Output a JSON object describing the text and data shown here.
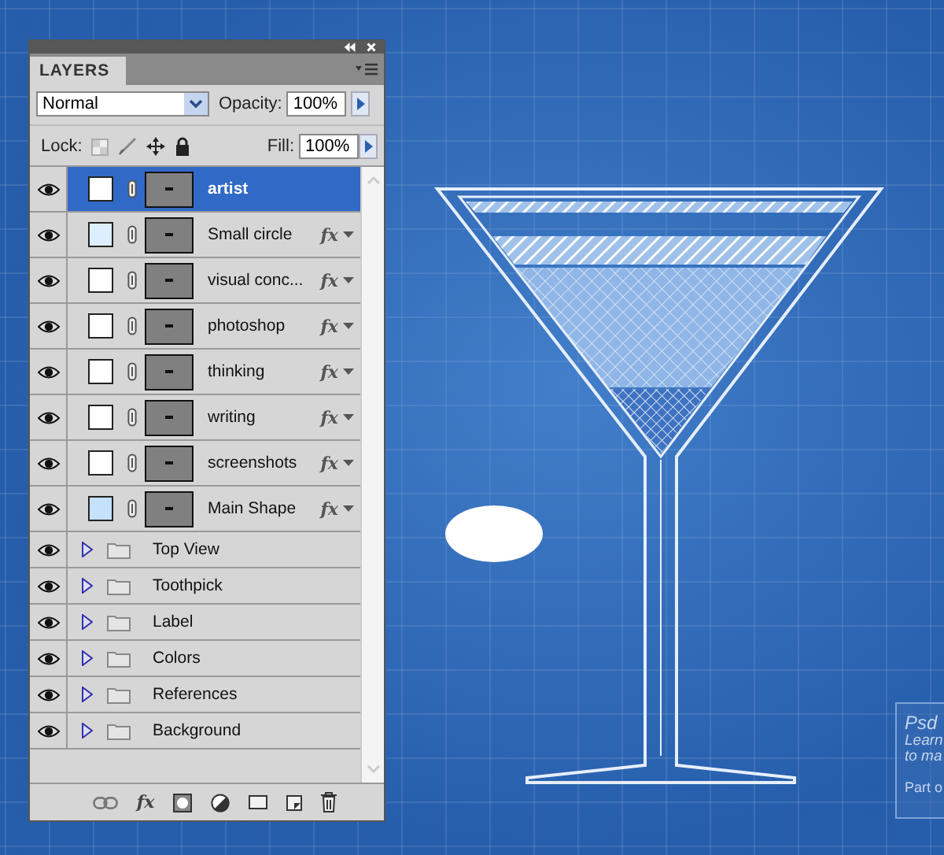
{
  "panel": {
    "title": "LAYERS",
    "blend_mode": "Normal",
    "opacity_label": "Opacity:",
    "opacity": "100%",
    "lock_label": "Lock:",
    "fill_label": "Fill:",
    "fill": "100%",
    "toolbar_fx": "fx"
  },
  "layers": [
    {
      "kind": "layer",
      "name": "artist",
      "visible": true,
      "selected": true,
      "color": "#ffffff"
    },
    {
      "kind": "layer",
      "name": "Small circle",
      "visible": true,
      "selected": false,
      "color": "#ddeeff",
      "fx": "fx"
    },
    {
      "kind": "layer",
      "name": "visual conc...",
      "visible": true,
      "selected": false,
      "color": "#ffffff",
      "fx": "fx"
    },
    {
      "kind": "layer",
      "name": "photoshop",
      "visible": true,
      "selected": false,
      "color": "#ffffff",
      "fx": "fx"
    },
    {
      "kind": "layer",
      "name": "thinking",
      "visible": true,
      "selected": false,
      "color": "#ffffff",
      "fx": "fx"
    },
    {
      "kind": "layer",
      "name": "writing",
      "visible": true,
      "selected": false,
      "color": "#ffffff",
      "fx": "fx"
    },
    {
      "kind": "layer",
      "name": "screenshots",
      "visible": true,
      "selected": false,
      "color": "#ffffff",
      "fx": "fx"
    },
    {
      "kind": "layer",
      "name": "Main Shape",
      "visible": true,
      "selected": false,
      "color": "#c4e2fb",
      "fx": "fx"
    },
    {
      "kind": "group",
      "name": "Top View",
      "visible": true,
      "selected": false,
      "expanded": false
    },
    {
      "kind": "group",
      "name": "Toothpick",
      "visible": true,
      "selected": false,
      "expanded": false
    },
    {
      "kind": "group",
      "name": "Label",
      "visible": true,
      "selected": false,
      "expanded": false
    },
    {
      "kind": "group",
      "name": "Colors",
      "visible": true,
      "selected": false,
      "expanded": false
    },
    {
      "kind": "group",
      "name": "References",
      "visible": true,
      "selected": false,
      "expanded": false
    },
    {
      "kind": "group",
      "name": "Background",
      "visible": true,
      "selected": false,
      "expanded": false
    }
  ],
  "canvas": {
    "info_card": {
      "title": "Psd",
      "lines": [
        "Learn",
        "to ma"
      ],
      "footer": "Part o"
    }
  }
}
